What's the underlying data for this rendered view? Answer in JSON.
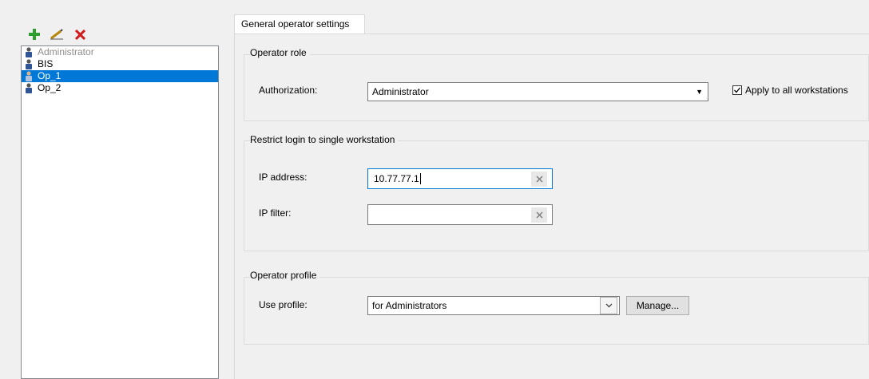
{
  "toolbar": {
    "icons": [
      "add-icon",
      "rename-icon",
      "delete-icon"
    ],
    "colors": {
      "add": "#2e9e2e",
      "delete": "#d01c1c"
    }
  },
  "operators": [
    {
      "label": "Administrator",
      "disabled": true,
      "selected": false
    },
    {
      "label": "BIS",
      "disabled": false,
      "selected": false
    },
    {
      "label": "Op_1",
      "disabled": false,
      "selected": true
    },
    {
      "label": "Op_2",
      "disabled": false,
      "selected": false
    }
  ],
  "tab": {
    "label": "General operator settings"
  },
  "operator_role": {
    "title": "Operator role",
    "authorization_label": "Authorization:",
    "authorization_value": "Administrator",
    "apply_all_label": "Apply to all workstations",
    "apply_all_checked": true
  },
  "restrict_login": {
    "title": "Restrict login to single workstation",
    "ip_address_label": "IP address:",
    "ip_address_value": "10.77.77.1",
    "ip_filter_label": "IP filter:",
    "ip_filter_value": ""
  },
  "operator_profile": {
    "title": "Operator profile",
    "use_profile_label": "Use profile:",
    "use_profile_value": "for Administrators",
    "manage_label": "Manage..."
  },
  "colors": {
    "selection": "#0078d7",
    "window_bg": "#f0f0f0",
    "disabled_text": "#8c8c8c"
  }
}
